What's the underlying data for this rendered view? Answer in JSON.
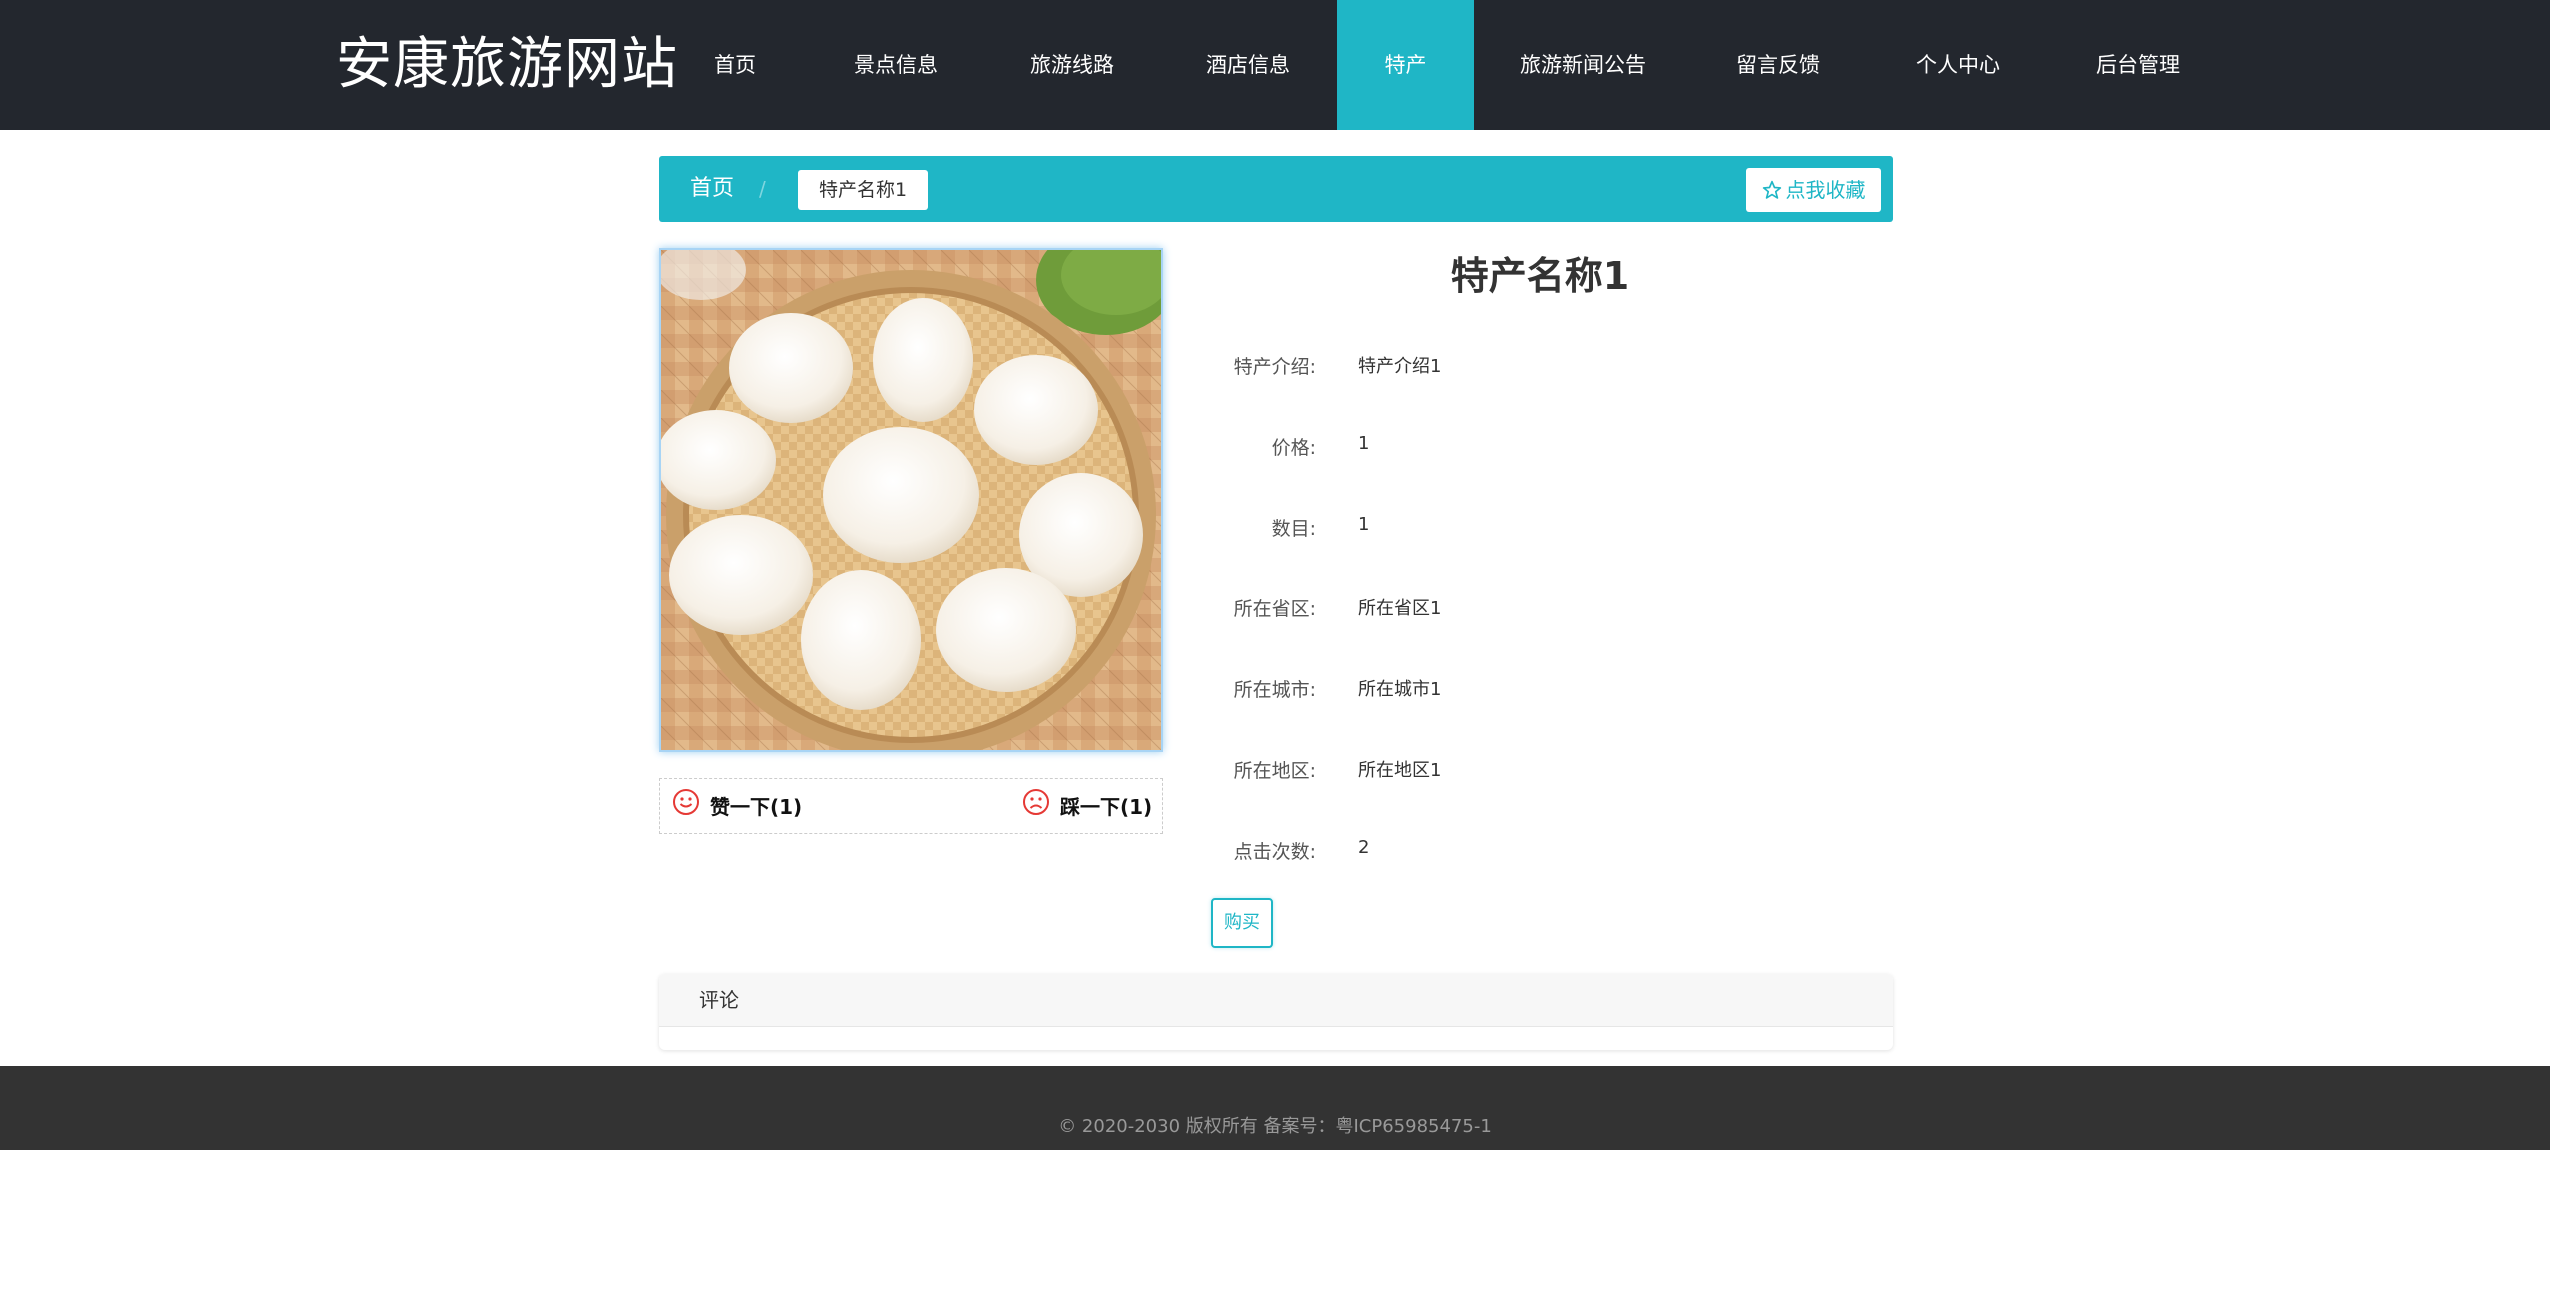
{
  "site": {
    "logo": "安康旅游网站"
  },
  "nav": {
    "items": [
      {
        "label": "首页"
      },
      {
        "label": "景点信息"
      },
      {
        "label": "旅游线路"
      },
      {
        "label": "酒店信息"
      },
      {
        "label": "特产",
        "active": true
      },
      {
        "label": "旅游新闻公告"
      },
      {
        "label": "留言反馈"
      },
      {
        "label": "个人中心"
      },
      {
        "label": "后台管理"
      }
    ]
  },
  "breadcrumb": {
    "home": "首页",
    "separator": "/",
    "current": "特产名称1"
  },
  "favorite": {
    "label": "点我收藏",
    "icon": "star-outline-icon"
  },
  "product": {
    "title": "特产名称1",
    "image_alt": "特产图片",
    "fields": [
      {
        "label": "特产介绍:",
        "value": "特产介绍1"
      },
      {
        "label": "价格:",
        "value": "1"
      },
      {
        "label": "数目:",
        "value": "1"
      },
      {
        "label": "所在省区:",
        "value": "所在省区1"
      },
      {
        "label": "所在城市:",
        "value": "所在城市1"
      },
      {
        "label": "所在地区:",
        "value": "所在地区1"
      },
      {
        "label": "点击次数:",
        "value": "2"
      }
    ],
    "like": {
      "label": "赞一下(1)",
      "icon": "smile-icon"
    },
    "dislike": {
      "label": "踩一下(1)",
      "icon": "frown-icon"
    },
    "buy": {
      "label": "购买"
    }
  },
  "comments": {
    "title": "评论"
  },
  "footer": {
    "text": "© 2020-2030 版权所有 备案号：粤ICP65985475-1"
  },
  "colors": {
    "header_bg": "#23272e",
    "accent": "#1fb6c6",
    "footer_bg": "#333333",
    "vote_icon": "#e53935"
  }
}
